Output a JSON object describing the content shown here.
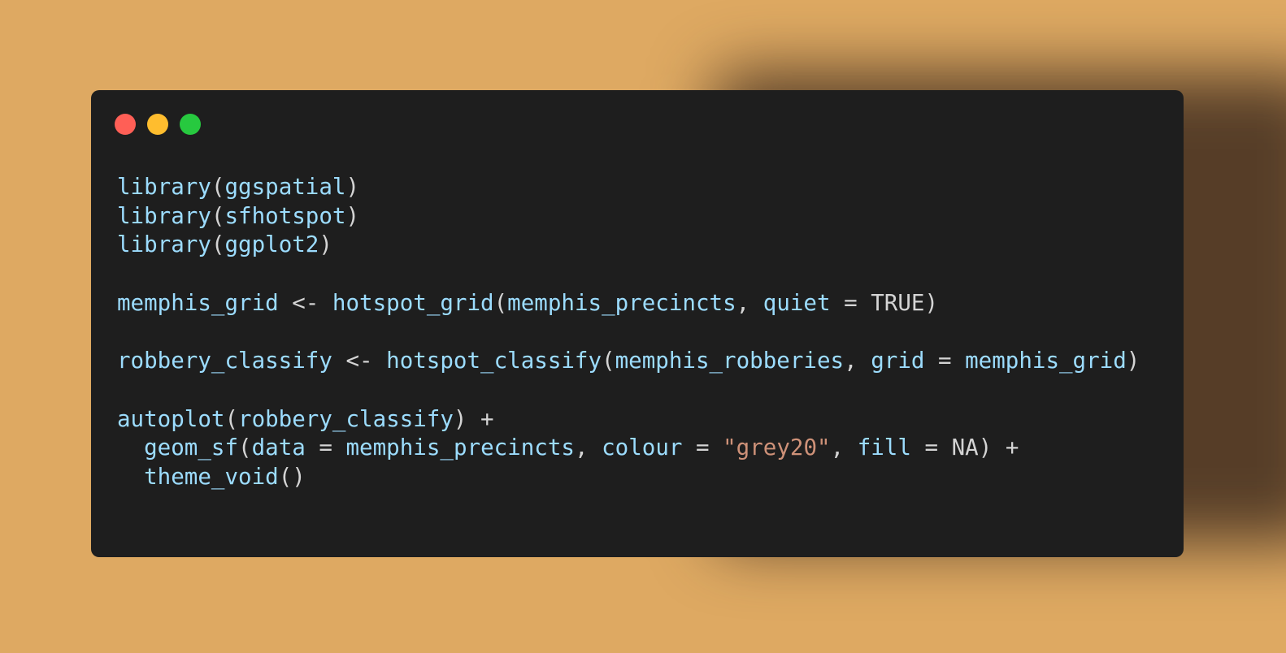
{
  "window": {
    "controls": [
      {
        "name": "close",
        "color": "#ff5f56"
      },
      {
        "name": "minimize",
        "color": "#ffbd2e"
      },
      {
        "name": "maximize",
        "color": "#27c93f"
      }
    ]
  },
  "colors": {
    "background": "#dea962",
    "window": "#1e1e1e",
    "identifier": "#9cdcfe",
    "string": "#ce9178",
    "plain": "#d4d4d4"
  },
  "code": {
    "lines": [
      [
        {
          "t": "id",
          "v": "library"
        },
        {
          "t": "plain",
          "v": "("
        },
        {
          "t": "id",
          "v": "ggspatial"
        },
        {
          "t": "plain",
          "v": ")"
        }
      ],
      [
        {
          "t": "id",
          "v": "library"
        },
        {
          "t": "plain",
          "v": "("
        },
        {
          "t": "id",
          "v": "sfhotspot"
        },
        {
          "t": "plain",
          "v": ")"
        }
      ],
      [
        {
          "t": "id",
          "v": "library"
        },
        {
          "t": "plain",
          "v": "("
        },
        {
          "t": "id",
          "v": "ggplot2"
        },
        {
          "t": "plain",
          "v": ")"
        }
      ],
      [],
      [
        {
          "t": "id",
          "v": "memphis_grid"
        },
        {
          "t": "plain",
          "v": " <- "
        },
        {
          "t": "id",
          "v": "hotspot_grid"
        },
        {
          "t": "plain",
          "v": "("
        },
        {
          "t": "id",
          "v": "memphis_precincts"
        },
        {
          "t": "plain",
          "v": ", "
        },
        {
          "t": "id",
          "v": "quiet"
        },
        {
          "t": "plain",
          "v": " = TRUE)"
        }
      ],
      [],
      [
        {
          "t": "id",
          "v": "robbery_classify"
        },
        {
          "t": "plain",
          "v": " <- "
        },
        {
          "t": "id",
          "v": "hotspot_classify"
        },
        {
          "t": "plain",
          "v": "("
        },
        {
          "t": "id",
          "v": "memphis_robberies"
        },
        {
          "t": "plain",
          "v": ", "
        },
        {
          "t": "id",
          "v": "grid"
        },
        {
          "t": "plain",
          "v": " = "
        },
        {
          "t": "id",
          "v": "memphis_grid"
        },
        {
          "t": "plain",
          "v": ")"
        }
      ],
      [],
      [
        {
          "t": "id",
          "v": "autoplot"
        },
        {
          "t": "plain",
          "v": "("
        },
        {
          "t": "id",
          "v": "robbery_classify"
        },
        {
          "t": "plain",
          "v": ") +"
        }
      ],
      [
        {
          "t": "plain",
          "v": "  "
        },
        {
          "t": "id",
          "v": "geom_sf"
        },
        {
          "t": "plain",
          "v": "("
        },
        {
          "t": "id",
          "v": "data"
        },
        {
          "t": "plain",
          "v": " = "
        },
        {
          "t": "id",
          "v": "memphis_precincts"
        },
        {
          "t": "plain",
          "v": ", "
        },
        {
          "t": "id",
          "v": "colour"
        },
        {
          "t": "plain",
          "v": " = "
        },
        {
          "t": "str",
          "v": "\"grey20\""
        },
        {
          "t": "plain",
          "v": ", "
        },
        {
          "t": "id",
          "v": "fill"
        },
        {
          "t": "plain",
          "v": " = NA) +"
        }
      ],
      [
        {
          "t": "plain",
          "v": "  "
        },
        {
          "t": "id",
          "v": "theme_void"
        },
        {
          "t": "plain",
          "v": "()"
        }
      ]
    ]
  }
}
